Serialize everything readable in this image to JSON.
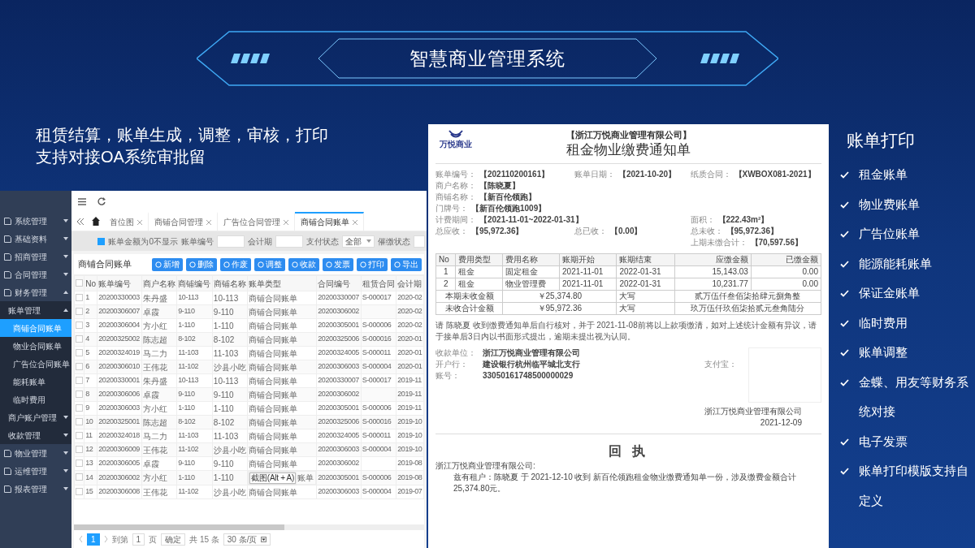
{
  "header": {
    "title": "智慧商业管理系统"
  },
  "intro": [
    "租赁结算，账单生成，调整，审核，打印",
    "支持对接OA系统审批留"
  ],
  "app": {
    "sidebar": [
      {
        "label": "系统管理",
        "expanded": false,
        "selected": false
      },
      {
        "label": "基础资料",
        "expanded": false,
        "selected": false
      },
      {
        "label": "招商管理",
        "expanded": false,
        "selected": false
      },
      {
        "label": "合同管理",
        "expanded": false,
        "selected": false
      },
      {
        "label": "财务管理",
        "expanded": true,
        "selected": false,
        "children": [
          {
            "label": "账单管理",
            "expanded": true,
            "selected": false,
            "children": [
              {
                "label": "商铺合同账单",
                "selected": true
              },
              {
                "label": "物业合同账单",
                "selected": false
              },
              {
                "label": "广告位合同账单",
                "selected": false
              },
              {
                "label": "能耗账单",
                "selected": false
              },
              {
                "label": "临时费用",
                "selected": false
              }
            ]
          },
          {
            "label": "商户账户管理",
            "expanded": false,
            "selected": false
          },
          {
            "label": "收款管理",
            "expanded": false,
            "selected": false
          }
        ]
      },
      {
        "label": "物业管理",
        "expanded": false,
        "selected": false
      },
      {
        "label": "运维管理",
        "expanded": false,
        "selected": false
      },
      {
        "label": "报表管理",
        "expanded": false,
        "selected": false
      }
    ],
    "tabs": [
      {
        "label": "首位图",
        "selected": false
      },
      {
        "label": "商铺合同管理",
        "selected": false
      },
      {
        "label": "广告位合同管理",
        "selected": false
      },
      {
        "label": "商铺合同账单",
        "selected": true
      }
    ],
    "filters": {
      "hide_zero": {
        "label": "账单金额为0不显示",
        "checked": true
      },
      "fields": [
        {
          "label": "账单编号",
          "kind": "input"
        },
        {
          "label": "会计期",
          "kind": "input"
        },
        {
          "label": "支付状态",
          "kind": "select",
          "value": "全部"
        },
        {
          "label": "催缴状态",
          "kind": "input"
        }
      ]
    },
    "card_title": "商铺合同账单",
    "buttons": [
      "新增",
      "删除",
      "作废",
      "调整",
      "收款",
      "发票",
      "打印",
      "导出"
    ],
    "table": {
      "select_all": false,
      "columns": [
        "No",
        "账单编号",
        "商户名称",
        "商铺编号",
        "商铺名称",
        "账单类型",
        "合同编号",
        "租赁合同",
        "会计期"
      ],
      "rows": [
        {
          "checked": false,
          "cells": [
            "1",
            "20200330003",
            "朱丹盛",
            "10-113",
            "10-113",
            "商铺合同账单",
            "20200330007",
            "S-000017",
            "2020-02"
          ]
        },
        {
          "checked": false,
          "cells": [
            "2",
            "20200306007",
            "卓霞",
            "9-110",
            "9-110",
            "商铺合同账单",
            "20200306002",
            "",
            "2020-02"
          ]
        },
        {
          "checked": false,
          "cells": [
            "3",
            "20200306004",
            "方小红",
            "1-110",
            "1-110",
            "商铺合同账单",
            "20200305001",
            "S-000006",
            "2020-02"
          ]
        },
        {
          "checked": false,
          "cells": [
            "4",
            "20200325002",
            "陈志超",
            "8-102",
            "8-102",
            "商铺合同账单",
            "20200325006",
            "S-000016",
            "2020-01"
          ]
        },
        {
          "checked": false,
          "cells": [
            "5",
            "20200324019",
            "马二力",
            "11-103",
            "11-103",
            "商铺合同账单",
            "20200324005",
            "S-000011",
            "2020-01"
          ]
        },
        {
          "checked": false,
          "cells": [
            "6",
            "20200306010",
            "王伟花",
            "11-102",
            "沙县小吃",
            "商铺合同账单",
            "20200306003",
            "S-000004",
            "2020-01"
          ]
        },
        {
          "checked": false,
          "cells": [
            "7",
            "20200330001",
            "朱丹盛",
            "10-113",
            "10-113",
            "商铺合同账单",
            "20200330007",
            "S-000017",
            "2019-11"
          ]
        },
        {
          "checked": false,
          "cells": [
            "8",
            "20200306006",
            "卓霞",
            "9-110",
            "9-110",
            "商铺合同账单",
            "20200306002",
            "",
            "2019-11"
          ]
        },
        {
          "checked": false,
          "cells": [
            "9",
            "20200306003",
            "方小红",
            "1-110",
            "1-110",
            "商铺合同账单",
            "20200305001",
            "S-000006",
            "2019-11"
          ]
        },
        {
          "checked": false,
          "cells": [
            "10",
            "20200325001",
            "陈志超",
            "8-102",
            "8-102",
            "商铺合同账单",
            "20200325006",
            "S-000016",
            "2019-10"
          ]
        },
        {
          "checked": false,
          "cells": [
            "11",
            "20200324018",
            "马二力",
            "11-103",
            "11-103",
            "商铺合同账单",
            "20200324005",
            "S-000011",
            "2019-10"
          ]
        },
        {
          "checked": false,
          "cells": [
            "12",
            "20200306009",
            "王伟花",
            "11-102",
            "沙县小吃",
            "商铺合同账单",
            "20200306003",
            "S-000004",
            "2019-10"
          ]
        },
        {
          "checked": false,
          "cells": [
            "13",
            "20200306005",
            "卓霞",
            "9-110",
            "9-110",
            "商铺合同账单",
            "20200306002",
            "",
            "2019-08"
          ]
        },
        {
          "checked": false,
          "cells": [
            "14",
            "20200306002",
            "方小红",
            "1-110",
            "1-110",
            "账单",
            "20200305001",
            "S-000006",
            "2019-08"
          ],
          "tooltip": "截图(Alt + A)"
        },
        {
          "checked": false,
          "cells": [
            "15",
            "20200306008",
            "王伟花",
            "11-102",
            "沙县小吃",
            "商铺合同账单",
            "20200306003",
            "S-000004",
            "2019-07"
          ]
        }
      ]
    },
    "pagination": {
      "pages": [
        {
          "label": "1",
          "selected": true
        }
      ],
      "goto_label": "到第",
      "goto_value": "1",
      "page_unit": "页",
      "confirm": "确定",
      "total": "共 15 条",
      "page_size": "30 条/页"
    }
  },
  "notice": {
    "logo_text": "万悦商业",
    "company": "【浙江万悦商业管理有限公司】",
    "title": "租金物业缴费通知单",
    "info_rows": [
      [
        {
          "label": "账单编号：",
          "value": "【202110200161】"
        },
        {
          "label": "账单日期：",
          "value": "【2021-10-20】"
        },
        {
          "label": "纸质合同：",
          "value": "【XWBOX081-2021】"
        }
      ],
      [
        {
          "label": "商户名称：",
          "value": "【陈晓夏】"
        },
        null,
        null
      ],
      [
        {
          "label": "商铺名称：",
          "value": "【新百伦领跑】"
        },
        null,
        null
      ],
      [
        {
          "label": "门牌号：",
          "value": "【新百伦领跑1009】"
        },
        null,
        null
      ],
      [
        {
          "label": "计费期间：",
          "value": "【2021-11-01~2022-01-31】"
        },
        null,
        {
          "label": "面积：",
          "value": "【222.43m²】"
        }
      ],
      [
        {
          "label": "总应收：",
          "value": "【95,972.36】"
        },
        {
          "label": "总已收：",
          "value": "【0.00】"
        },
        {
          "label": "总未收：",
          "value": "【95,972.36】"
        }
      ],
      [
        null,
        null,
        {
          "label": "上期未缴合计：",
          "value": "【70,597.56】"
        }
      ]
    ],
    "charges": {
      "columns": [
        "No",
        "费用类型",
        "费用名称",
        "账期开始",
        "账期结束",
        "应缴金额",
        "已缴金额"
      ],
      "rows": [
        [
          "1",
          "租金",
          "固定租金",
          "2021-11-01",
          "2022-01-31",
          "15,143.03",
          "0.00"
        ],
        [
          "2",
          "租金",
          "物业管理费",
          "2021-11-01",
          "2022-01-31",
          "10,231.77",
          "0.00"
        ]
      ],
      "summaries": [
        {
          "label": "本期未收金额",
          "amount": "￥25,374.80",
          "caps_label": "大写",
          "caps": "贰万伍仟叁佰柒拾肆元捌角整"
        },
        {
          "label": "未收合计金额",
          "amount": "￥95,972.36",
          "caps_label": "大写",
          "caps": "玖万伍仟玖佰柒拾贰元叁角陆分"
        }
      ]
    },
    "message": "请 陈晓夏 收到缴费通知单后自行核对，并于 2021-11-08前将以上款项缴清，如对上述统计金额有异议，请于接单后3日内以书面形式提出，逾期未提出视为认同。",
    "payee": [
      {
        "label": "收款单位：",
        "value": "浙江万悦商业管理有限公司"
      },
      {
        "label": "开户行：",
        "value": "建设银行杭州临平城北支行"
      },
      {
        "label": "账号：",
        "value": "33050161748500000029"
      }
    ],
    "alipay_label": "支付宝：",
    "signature": {
      "company": "浙江万悦商业管理有限公司",
      "date": "2021-12-09"
    },
    "receipt": {
      "title": "回 执",
      "addressee": "浙江万悦商业管理有限公司:",
      "body": "兹有租户：陈晓夏 于 2021-12-10 收到 新百伦领跑租金物业缴费通知单一份，涉及缴费金额合计25,374.80元。"
    }
  },
  "features": {
    "title": "账单打印",
    "items": [
      "租金账单",
      "物业费账单",
      "广告位账单",
      "能源能耗账单",
      "保证金账单",
      "临时费用",
      "账单调整",
      "金蝶、用友等财务系统对接",
      "电子发票",
      "账单打印模版支持自定义"
    ]
  }
}
